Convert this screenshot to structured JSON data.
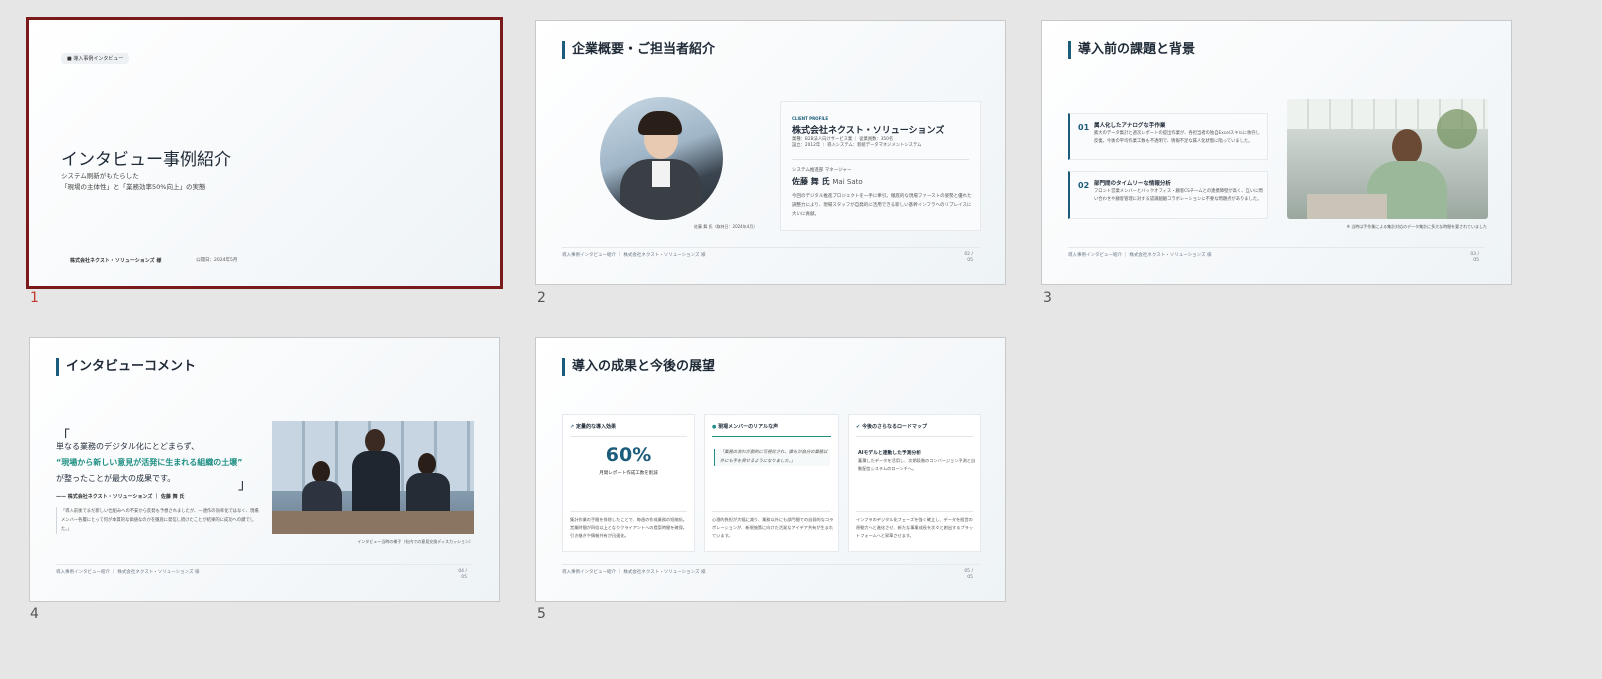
{
  "slides": [
    {
      "number": "1",
      "badge": "導入事例インタビュー",
      "title": "インタビュー事例紹介",
      "subtitle1": "システム刷新がもたらした",
      "subtitle2": "「現場の主体性」と「業務効率50%向上」の実態",
      "company": "株式会社ネクスト・ソリューションズ 様",
      "date": "公開日：2024年5月"
    },
    {
      "number": "2",
      "title": "企業概要・ご担当者紹介",
      "profile_label": "CLIENT PROFILE",
      "company": "株式会社ネクスト・ソリューションズ",
      "meta1": "業種：B2B法人向けサービス業 ｜ 従業員数：350名",
      "meta2": "設立：2012年 ｜ 導入システム：新統データマネジメントシステム",
      "role": "システム推進部 マネージャー",
      "person": "佐藤 舞 氏",
      "person_en": "Mai Sato",
      "desc": "今回のデジタル推進プロジェクトを一手に牽引。徹底的な現場ファーストの姿勢と優れた調整力により、現場スタッフが自発的に活用できる新しい基幹インフラへのリプレイスに大いに貢献。",
      "caption": "佐藤 舞 氏（取材日：2024年4月）",
      "footer": "導入事例インタビュー紹介 ｜ 株式会社ネクスト・ソリューションズ 様",
      "page": "02 /",
      "page_total": "05"
    },
    {
      "number": "3",
      "title": "導入前の課題と背景",
      "issue1_num": "01",
      "issue1_title": "属人化したアナログな手作業",
      "issue1_text": "膨大のデータ集計と週次レポートの提出作業が、各担当者の独自Excelスキルに依存し反復。今後の平均作業工数も不透明で、情報不足な属人化状態に陥っていました。",
      "issue2_num": "02",
      "issue2_title": "部門間のタイムリーな情報分析",
      "issue2_text": "フロント営業メンバーとバックオフィス・顧客CSチームとの連携障壁が高く、互いに問い合わせや顧客管理に対する認識齟齬コラボレーションに不要な問題点がありました。",
      "caption": "※ 当時は手作業による集計対応のデータ集計に多大な時間を要されていました",
      "footer": "導入事例インタビュー紹介 ｜ 株式会社ネクスト・ソリューションズ 様",
      "page": "03 /",
      "page_total": "05"
    },
    {
      "number": "4",
      "title": "インタビューコメント",
      "quote1": "単なる業務のデジタル化にとどまらず、",
      "quote2": "“現場から新しい意見が活発に生まれる組織の土壌”",
      "quote3": "が整ったことが最大の成果です。",
      "attribution": "—— 株式会社ネクスト・ソリューションズ ｜ 佐藤 舞 氏",
      "detail": "「導入前後でまだ新しい仕組みへの不安から反発も予想されましたが、一連作の効率化ではなく、現場メンバー各層にとって何が本質的な価値なのかを徹底に発信し続けたことが結果的に成功への鍵でした。」",
      "caption": "インタビュー当時の様子（社内での意見交換ディスカッション）",
      "footer": "導入事例インタビュー紹介 ｜ 株式会社ネクスト・ソリューションズ 様",
      "page": "04 /",
      "page_total": "05"
    },
    {
      "number": "5",
      "title": "導入の成果と今後の展望",
      "col1_title": "定量的な導入効果",
      "col1_value": "60%",
      "col1_value_label": "月間レポート作成工数を削減",
      "col1_text": "集計作業の手間を排除したことで、毎週の作成業務の短縮化。営業時間が四倍以上となりクライアントへの提案時間を確保。引き継ぎや情報共有が迅速化。",
      "col2_title": "現場メンバーのリアルな声",
      "col2_quote": "「業務の流れが劇的に可視化され、誰もが自分の業務以外にも手を貸せるようになりました。」",
      "col2_text": "心理的負担が大幅に減り、業務以外にも部門間での自発的なコラボレーションが、新規施策に向けた活発なアイデア共有が生まれています。",
      "col3_title": "今後のさらなるロードマップ",
      "col3_sub": "AIモデルと連動した予測分析",
      "col3_sub_text": "蓄積したデータを活用し、次期段階のコンバージョン予測と自動配信システムのローンチへ。",
      "col3_text": "インフラのデジタル化フェーズを強く確立し、データを経営の原動力へと進化させ、新たな事業成長を次々と創出するプラットフォームへと昇華させます。",
      "footer": "導入事例インタビュー紹介 ｜ 株式会社ネクスト・ソリューションズ 様",
      "page": "05 /",
      "page_total": "05"
    }
  ],
  "colors": {
    "accent": "#1b5c7a",
    "teal": "#1d8f83",
    "selected": "#7a1a1a"
  }
}
